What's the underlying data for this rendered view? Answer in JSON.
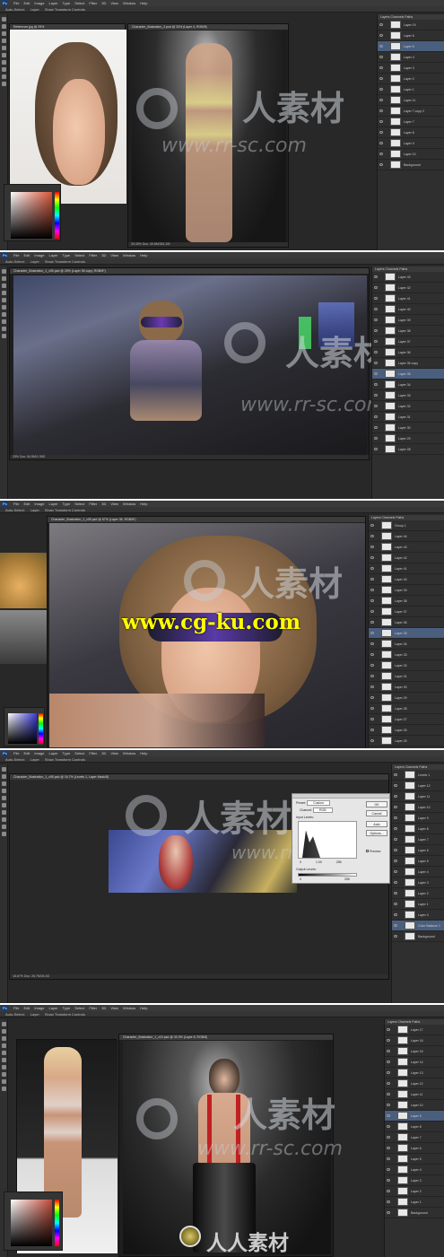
{
  "menu": {
    "logo": "Ps",
    "items": [
      "File",
      "Edit",
      "Image",
      "Layer",
      "Type",
      "Select",
      "Filter",
      "3D",
      "View",
      "Window",
      "Help"
    ]
  },
  "options": {
    "items": [
      "Auto-Select:",
      "Layer",
      "Show Transform Controls"
    ]
  },
  "layers_tabs": "Layers  Channels  Paths",
  "screens": [
    {
      "doc_title": "Character_Illustration_2.psd @ 33% (Layer 4, RGB/8)",
      "ref_title": "Reference.jpg @ 25%",
      "status": "33.33%   Doc: 45.8M/361.2M"
    },
    {
      "doc_title": "Character_Illustration_1_v05.psd @ 25% (Layer 35 copy, RGB/8*)",
      "status": "25%   Doc: 54.5M/1.95G"
    },
    {
      "doc_title": "Character_Illustration_1_v05.psd @ 67% (Layer 35, RGB/8*)",
      "status": "66.67%"
    },
    {
      "doc_title": "Character_Illustration_1_v05.psd @ 16.7% (Levels 1, Layer Mask/8)",
      "status": "16.67%   Doc: 26.7M/24.4G"
    },
    {
      "doc_title": "Character_Illustration_1_v10.psd @ 33.3% (Layer 8, RGB/8)",
      "status": "33.33%   Doc: 45.8M/361.2M"
    }
  ],
  "levels_dialog": {
    "preset_label": "Preset:",
    "preset_value": "Custom",
    "channel_label": "Channel:",
    "channel_value": "RGB",
    "input_label": "Input Levels:",
    "output_label": "Output Levels:",
    "input_values": [
      "0",
      "1.00",
      "255"
    ],
    "output_values": [
      "0",
      "255"
    ],
    "buttons": [
      "OK",
      "Cancel",
      "Auto",
      "Options..."
    ],
    "preview": "Preview"
  },
  "watermark": {
    "cn": "人人素材",
    "cn_short": "人素材",
    "url": "www.rr-sc.com",
    "cg": "www.cg-ku.com"
  },
  "layers": [
    [
      "Layer 19",
      "Layer 6",
      "Layer 5",
      "Layer 4",
      "Layer 3",
      "Layer 2",
      "Layer 1",
      "Layer 11",
      "Layer 7 copy 2",
      "Layer 7",
      "Layer 8",
      "Layer 9",
      "Layer 10",
      "Background"
    ],
    [
      "Layer 43",
      "Layer 42",
      "Layer 41",
      "Layer 40",
      "Layer 39",
      "Layer 38",
      "Layer 37",
      "Layer 36",
      "Layer 35 copy",
      "Layer 35",
      "Layer 34",
      "Layer 33",
      "Layer 32",
      "Layer 31",
      "Layer 30",
      "Layer 29",
      "Layer 28"
    ],
    [
      "Group 1",
      "Layer 44",
      "Layer 43",
      "Layer 42",
      "Layer 41",
      "Layer 40",
      "Layer 39",
      "Layer 38",
      "Layer 37",
      "Layer 36",
      "Layer 35",
      "Layer 34",
      "Layer 33",
      "Layer 32",
      "Layer 31",
      "Layer 30",
      "Layer 29",
      "Layer 28",
      "Layer 27",
      "Layer 26",
      "Layer 25"
    ],
    [
      "Levels 1",
      "Layer 12",
      "Layer 11",
      "Layer 10",
      "Layer 9",
      "Layer 8",
      "Layer 7",
      "Layer 6",
      "Layer 5",
      "Layer 4",
      "Layer 3",
      "Layer 2",
      "Layer 1",
      "Layer 0",
      "Color Balance 1",
      "Background"
    ],
    [
      "Layer 17",
      "Layer 16",
      "Layer 15",
      "Layer 14",
      "Layer 13",
      "Layer 12",
      "Layer 11",
      "Layer 10",
      "Layer 9",
      "Layer 8",
      "Layer 7",
      "Layer 6",
      "Layer 5",
      "Layer 4",
      "Layer 3",
      "Layer 2",
      "Layer 1",
      "Background"
    ]
  ],
  "selected_layer": [
    2,
    9,
    10,
    14,
    8
  ]
}
